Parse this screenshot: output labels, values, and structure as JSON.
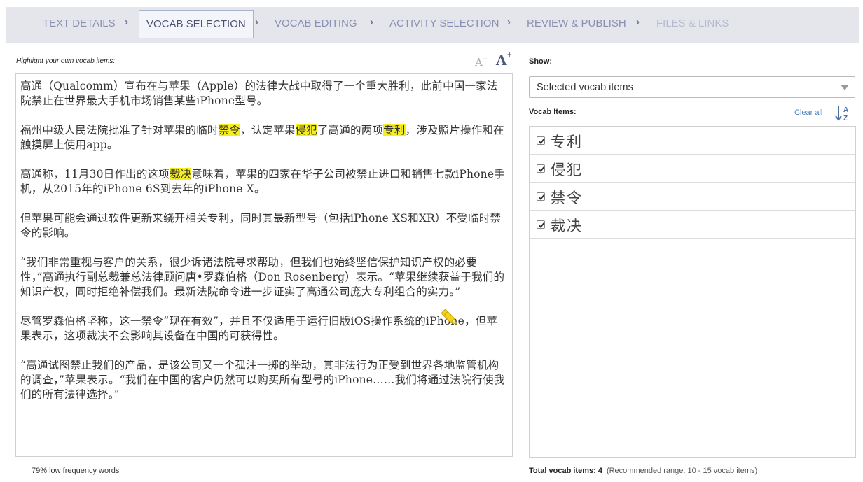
{
  "steps": [
    {
      "label": "TEXT DETAILS",
      "state": "default"
    },
    {
      "label": "VOCAB SELECTION",
      "state": "active"
    },
    {
      "label": "VOCAB EDITING",
      "state": "default"
    },
    {
      "label": "ACTIVITY SELECTION",
      "state": "default"
    },
    {
      "label": "REVIEW & PUBLISH",
      "state": "default"
    },
    {
      "label": "FILES & LINKS",
      "state": "disabled"
    }
  ],
  "chevron": "›",
  "editor": {
    "instruction": "Highlight your own vocab items:",
    "font_decrease": "A",
    "font_decrease_sup": "−",
    "font_increase": "A",
    "font_increase_sup": "+",
    "paragraphs": [
      [
        {
          "t": "高通（Qualcomm）宣布在与苹果（Apple）的法律大战中取得了一个重大胜利，此前中国一家法院禁止在世界最大手机市场销售某些iPhone型号。"
        }
      ],
      [
        {
          "t": "福州中级人民法院批准了针对苹果的临时"
        },
        {
          "t": "禁令",
          "hl": true
        },
        {
          "t": "，认定苹果"
        },
        {
          "t": "侵犯",
          "hl": true
        },
        {
          "t": "了高通的两项"
        },
        {
          "t": "专利",
          "hl": true
        },
        {
          "t": "，涉及照片操作和在触摸屏上使用app。"
        }
      ],
      [
        {
          "t": "高通称，11月30日作出的这项"
        },
        {
          "t": "裁决",
          "hl": true
        },
        {
          "t": "意味着，苹果的四家在华子公司被禁止进口和销售七款iPhone手机，从2015年的iPhone 6S到去年的iPhone X。"
        }
      ],
      [
        {
          "t": "但苹果可能会通过软件更新来绕开相关专利，同时其最新型号（包括iPhone XS和XR）不受临时禁令的影响。"
        }
      ],
      [
        {
          "t": "“我们非常重视与客户的关系，很少诉诸法院寻求帮助，但我们也始终坚信保护知识产权的必要性，”高通执行副总裁兼总法律顾问唐•罗森伯格（Don Rosenberg）表示。“苹果继续获益于我们的知识产权，同时拒绝补偿我们。最新法院命令进一步证实了高通公司庞大专利组合的实力。”"
        }
      ],
      [
        {
          "t": "尽管罗森伯格坚称，这一禁令“现在有效”，并且不仅适用于运行旧版iOS操作系统的iPhone，但苹果表示，这项裁决不会影响其设备在中国的可获得性。"
        }
      ],
      [
        {
          "t": "“高通试图禁止我们的产品，是该公司又一个孤注一掷的举动，其非法行为正受到世界各地监管机构的调查，”苹果表示。“我们在中国的客户仍然可以购买所有型号的iPhone……我们将通过法院行使我们的所有法律选择。”"
        }
      ]
    ],
    "frequency_note": "79% low frequency words"
  },
  "sidebar": {
    "show_label": "Show:",
    "show_selected": "Selected vocab items",
    "vocab_label": "Vocab Items:",
    "clear_all": "Clear all",
    "items": [
      {
        "word": "专利",
        "checked": true
      },
      {
        "word": "侵犯",
        "checked": true
      },
      {
        "word": "禁令",
        "checked": true
      },
      {
        "word": "裁决",
        "checked": true
      }
    ],
    "total_label": "Total vocab items: 4",
    "range_note": "(Recommended range: 10 - 15 vocab items)"
  },
  "icons": {
    "pencil": "highlighter-pencil-icon",
    "sort": "sort-az-icon",
    "dropdown": "chevron-down-icon",
    "checkbox": "checkmark-icon"
  },
  "colors": {
    "highlight": "#f7ee1e",
    "nav_background": "#e5e6ec",
    "link": "#4a7fc0",
    "pencil": "#f5d21c"
  }
}
